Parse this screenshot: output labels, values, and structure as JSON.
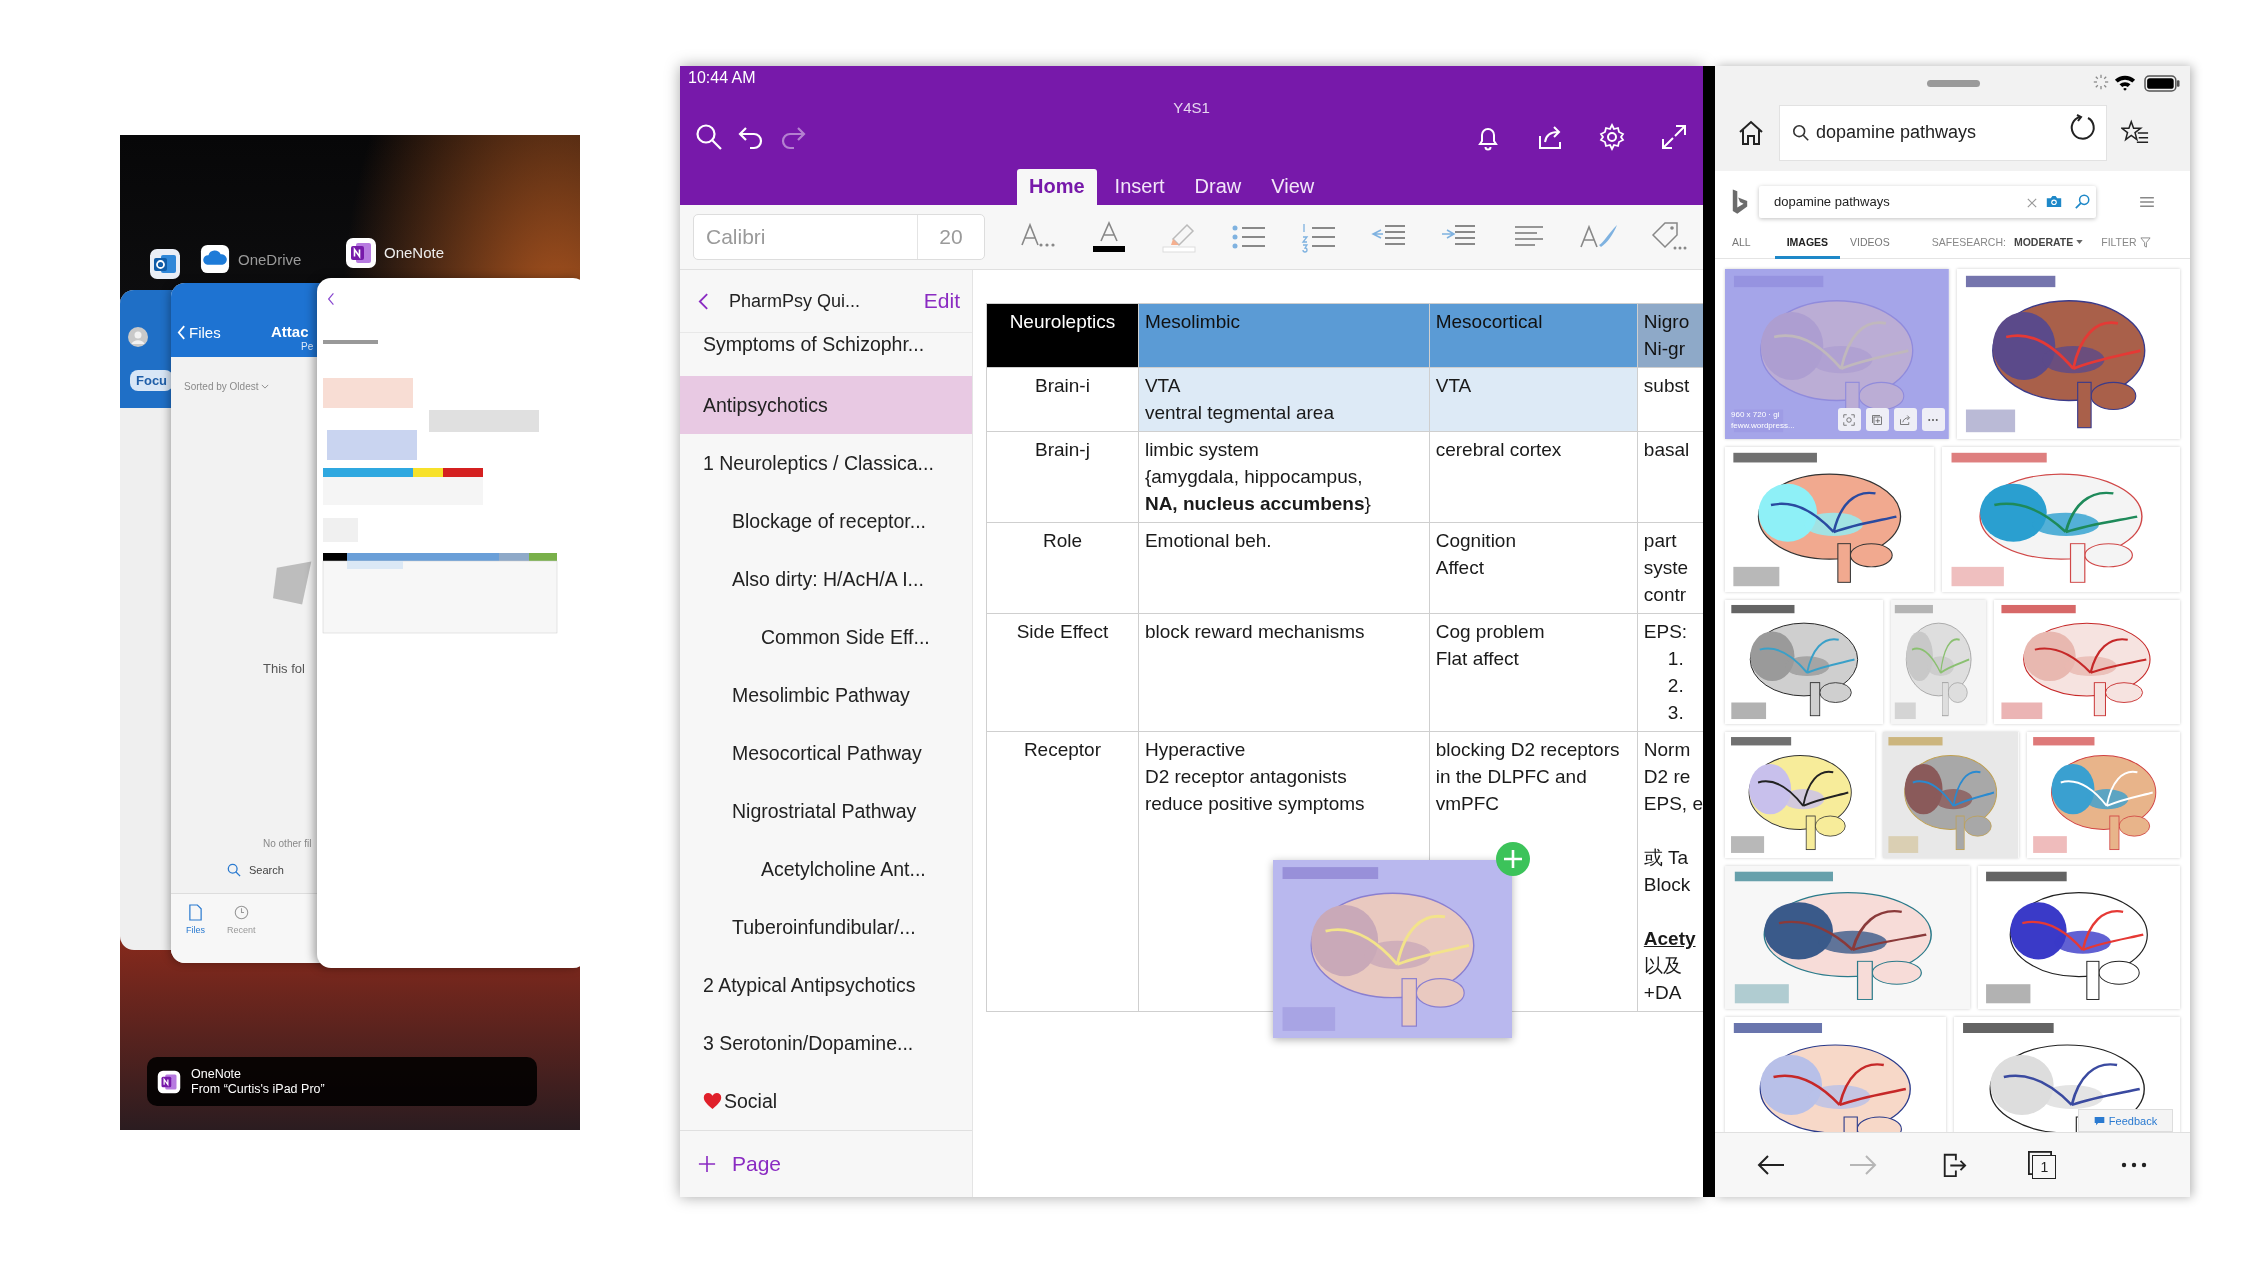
{
  "switcher": {
    "apps": [
      {
        "kind": "outlook"
      },
      {
        "kind": "onedrive",
        "label": "OneDrive"
      },
      {
        "kind": "onenote",
        "label": "OneNote"
      }
    ],
    "outlook_card": {
      "filter": "Focu"
    },
    "onedrive_card": {
      "back": "Files",
      "title": "Attac",
      "subtitle": "Pe",
      "sort": "Sorted by Oldest",
      "empty_text": "This fol",
      "footer_text": "No other fil",
      "search": "Search",
      "tabs": [
        {
          "label": "Files",
          "selected": true
        },
        {
          "label": "Recent",
          "selected": false
        }
      ]
    },
    "handoff": {
      "app": "OneNote",
      "source": "From “Curtis's iPad Pro”"
    }
  },
  "onenote": {
    "time": "10:44 AM",
    "notebook": "Y4S1",
    "redo_disabled": true,
    "ribbon_tabs": [
      {
        "label": "Home",
        "selected": true
      },
      {
        "label": "Insert",
        "selected": false
      },
      {
        "label": "Draw",
        "selected": false
      },
      {
        "label": "View",
        "selected": false
      }
    ],
    "font": {
      "name": "Calibri",
      "size": "20"
    },
    "section": "PharmPsy Qui...",
    "edit": "Edit",
    "pages": [
      {
        "title": "Symptoms of Schizophr...",
        "selected": false,
        "heart": false
      },
      {
        "title": "Antipsychotics",
        "selected": true,
        "heart": false
      },
      {
        "title": "1 Neuroleptics / Classica...",
        "selected": false,
        "heart": false,
        "children": [
          {
            "title": "Blockage of receptor...",
            "selected": false,
            "heart": false
          },
          {
            "title": "Also dirty: H/AcH/A I...",
            "selected": false,
            "heart": false,
            "children": [
              {
                "title": "Common Side Eff...",
                "selected": false,
                "heart": false
              }
            ]
          },
          {
            "title": "Mesolimbic Pathway",
            "selected": false,
            "heart": false
          },
          {
            "title": "Mesocortical Pathway",
            "selected": false,
            "heart": false
          },
          {
            "title": "Nigrostriatal Pathway",
            "selected": false,
            "heart": false,
            "children": [
              {
                "title": "Acetylcholine Ant...",
                "selected": false,
                "heart": false
              }
            ]
          },
          {
            "title": "Tuberoinfundibular/...",
            "selected": false,
            "heart": false
          }
        ]
      },
      {
        "title": "2 Atypical Antipsychotics",
        "selected": false,
        "heart": false
      },
      {
        "title": "3 Serotonin/Dopamine...",
        "selected": false,
        "heart": false
      },
      {
        "title": "Social",
        "selected": false,
        "heart": true
      }
    ],
    "add_page": "Page",
    "table": {
      "columns": [
        {
          "lines": [
            "Neuroleptics"
          ],
          "color": "#000000"
        },
        {
          "lines": [
            "Mesolimbic"
          ],
          "color": "#5b9bd5"
        },
        {
          "lines": [
            "Mesocortical"
          ],
          "color": "#5b9bd5"
        },
        {
          "lines": [
            "Nigro",
            "Ni-gr"
          ],
          "color": "#8ea9c8"
        }
      ],
      "rows": [
        {
          "cells": [
            {
              "lines": [
                "Brain-i"
              ],
              "shaded": false
            },
            {
              "lines": [
                "VTA",
                "ventral tegmental area"
              ],
              "shaded": true
            },
            {
              "lines": [
                "VTA"
              ],
              "shaded": true
            },
            {
              "lines": [
                "subst"
              ],
              "shaded": false
            }
          ]
        },
        {
          "cells": [
            {
              "lines": [
                "Brain-j"
              ],
              "shaded": false
            },
            {
              "lines": [
                "limbic system",
                "{amygdala, hippocampus,",
                "**NA, nucleus accumbens**}"
              ],
              "shaded": false
            },
            {
              "lines": [
                "cerebral cortex"
              ],
              "shaded": false
            },
            {
              "lines": [
                "basal"
              ],
              "shaded": false
            }
          ]
        },
        {
          "cells": [
            {
              "lines": [
                "Role"
              ],
              "shaded": false
            },
            {
              "lines": [
                "Emotional beh."
              ],
              "shaded": false
            },
            {
              "lines": [
                "Cognition",
                "Affect"
              ],
              "shaded": false
            },
            {
              "lines": [
                "part",
                "syste",
                "contr"
              ],
              "shaded": false
            }
          ]
        },
        {
          "cells": [
            {
              "lines": [
                "Side Effect"
              ],
              "shaded": false
            },
            {
              "lines": [
                "block reward mechanisms"
              ],
              "shaded": false
            },
            {
              "lines": [
                "Cog problem",
                "Flat affect"
              ],
              "shaded": false
            },
            {
              "lines": [
                "EPS:"
              ],
              "numbers": [
                "1.",
                "2.",
                "3."
              ],
              "shaded": false
            }
          ]
        },
        {
          "cells": [
            {
              "lines": [
                "Receptor"
              ],
              "shaded": false
            },
            {
              "lines": [
                "Hyperactive",
                "D2 receptor antagonists",
                "reduce positive symptoms"
              ],
              "shaded": false
            },
            {
              "lines": [
                "blocking D2 receptors",
                "in the DLPFC and",
                "vmPFC"
              ],
              "shaded": false
            },
            {
              "paragraphs": [
                {
                  "lines": [
                    "Norm",
                    "D2 re",
                    "EPS, e"
                  ],
                  "first_line_underlined": false
                },
                {
                  "lines": [
                    "或 Ta",
                    "Block"
                  ],
                  "first_line_underlined": false
                },
                {
                  "lines": [
                    "**Acety**",
                    "以及",
                    "+DA"
                  ],
                  "first_line_underlined": true
                }
              ],
              "shaded": false
            }
          ]
        }
      ]
    }
  },
  "browser": {
    "address": "dopamine pathways",
    "bing_query": "dopamine pathways",
    "tabs": [
      {
        "label": "ALL",
        "selected": false
      },
      {
        "label": "IMAGES",
        "selected": true
      },
      {
        "label": "VIDEOS",
        "selected": false
      }
    ],
    "safesearch_label": "SAFESEARCH:",
    "safesearch_value": "MODERATE",
    "filter": "FILTER",
    "image_info": [
      "960 x 720 · gi",
      "feww.wordpress..."
    ],
    "feedback": "Feedback",
    "tab_count": "1",
    "forward_disabled": true
  }
}
